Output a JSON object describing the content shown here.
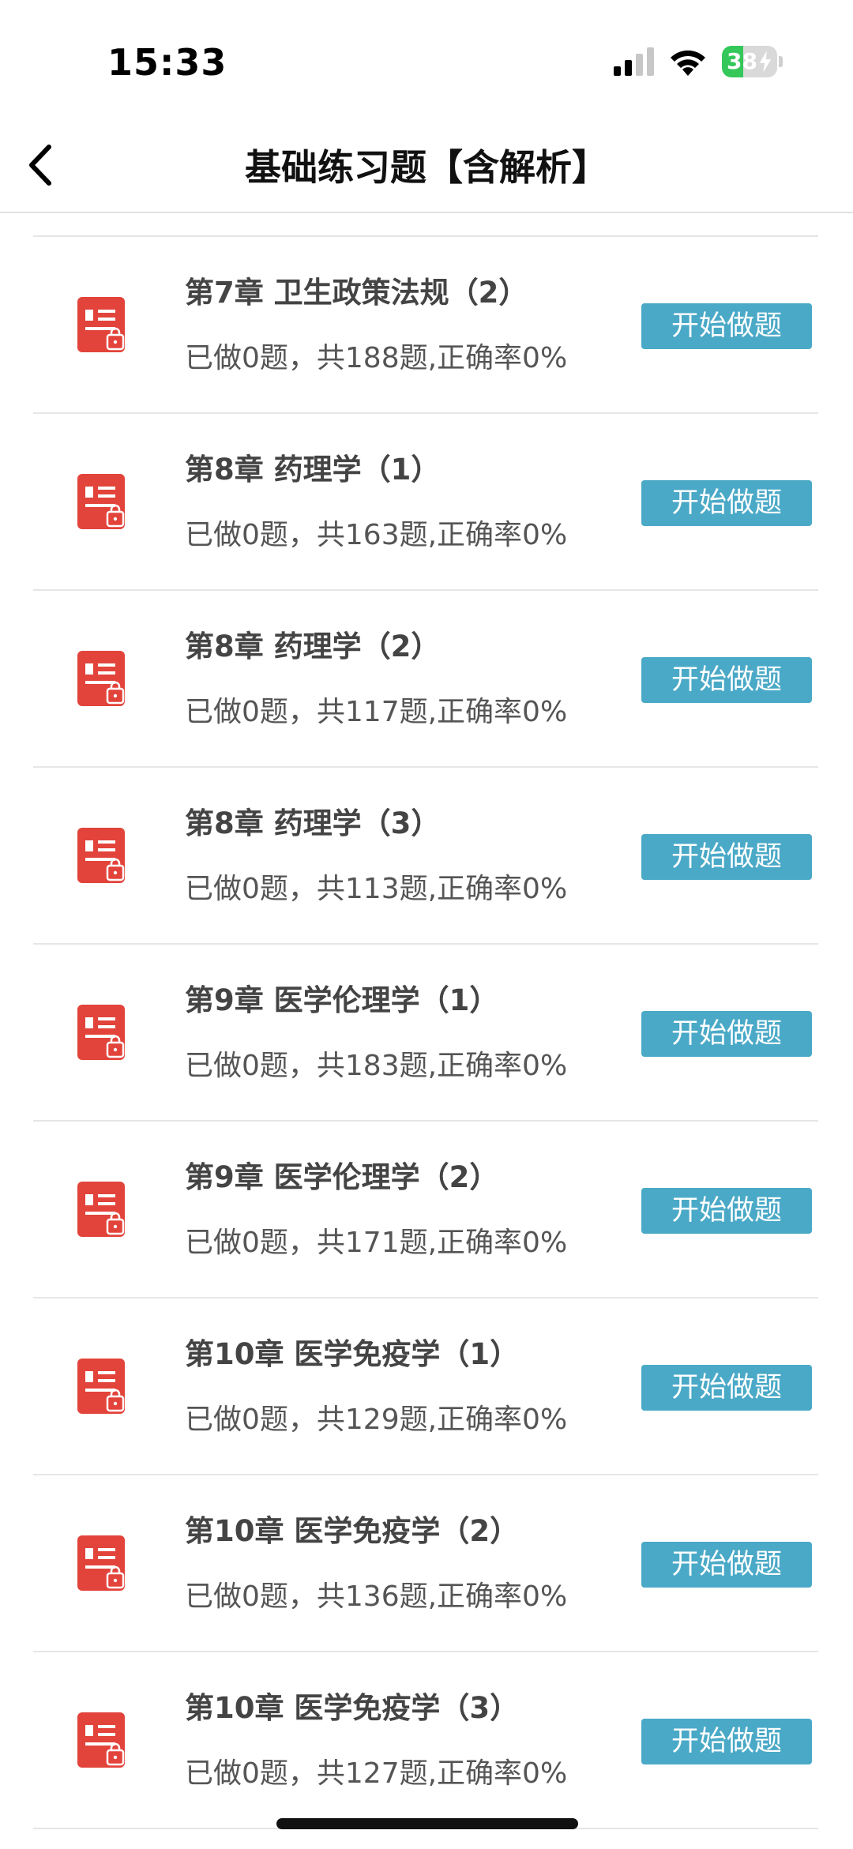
{
  "status_bar": {
    "time": "15:33",
    "battery_percent": "38",
    "battery_level": 0.38,
    "icons": [
      "signal-icon",
      "wifi-icon",
      "battery-icon"
    ]
  },
  "nav": {
    "title": "基础练习题【含解析】",
    "back_icon": "chevron-left-icon"
  },
  "colors": {
    "button_bg": "#4aa9c7",
    "icon_red": "#e2433a",
    "divider": "#e6e6e6",
    "battery_green": "#34c759"
  },
  "list": {
    "button_label": "开始做题",
    "item_icon": "locked-document-icon",
    "items": [
      {
        "title": "第7章 卫生政策法规（2）",
        "stats": "已做0题，共188题,正确率0%"
      },
      {
        "title": "第8章 药理学（1）",
        "stats": "已做0题，共163题,正确率0%"
      },
      {
        "title": "第8章 药理学（2）",
        "stats": "已做0题，共117题,正确率0%"
      },
      {
        "title": "第8章 药理学（3）",
        "stats": "已做0题，共113题,正确率0%"
      },
      {
        "title": "第9章 医学伦理学（1）",
        "stats": "已做0题，共183题,正确率0%"
      },
      {
        "title": "第9章 医学伦理学（2）",
        "stats": "已做0题，共171题,正确率0%"
      },
      {
        "title": "第10章 医学免疫学（1）",
        "stats": "已做0题，共129题,正确率0%"
      },
      {
        "title": "第10章 医学免疫学（2）",
        "stats": "已做0题，共136题,正确率0%"
      },
      {
        "title": "第10章 医学免疫学（3）",
        "stats": "已做0题，共127题,正确率0%"
      }
    ]
  }
}
